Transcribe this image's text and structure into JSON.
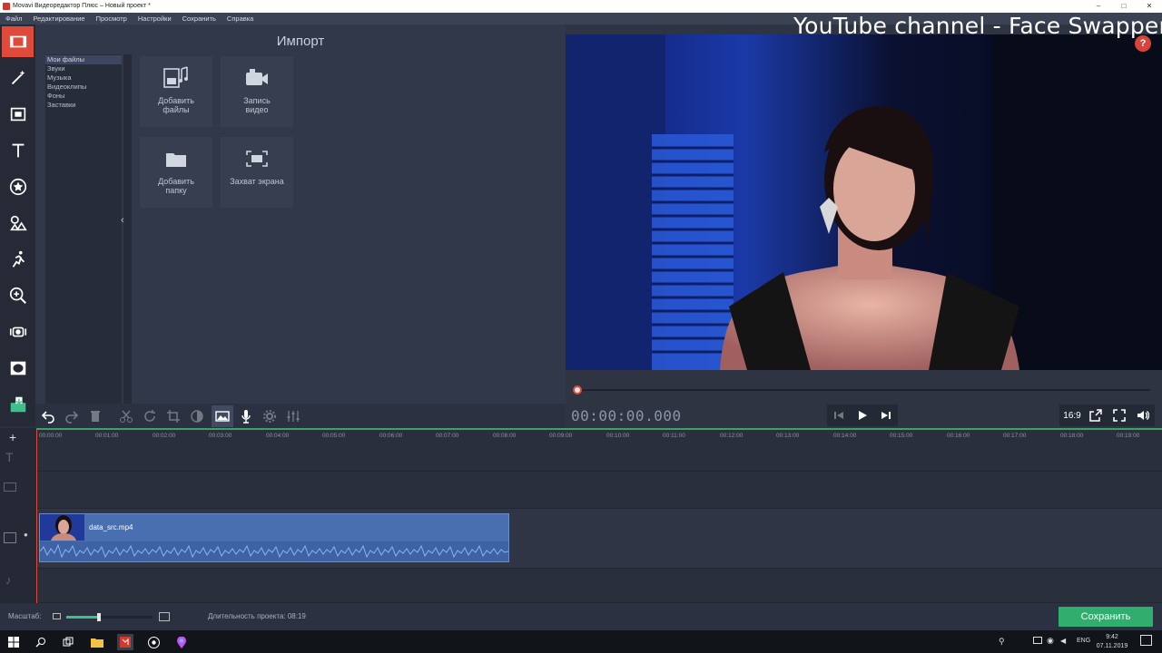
{
  "window": {
    "title": "Movavi Видеоредактор Плюс – Новый проект *",
    "controls": [
      "–",
      "□",
      "✕"
    ]
  },
  "menu": [
    "Файл",
    "Редактирование",
    "Просмотр",
    "Настройки",
    "Сохранить",
    "Справка"
  ],
  "sidebar_tools": [
    "import-icon",
    "magic-wand-icon",
    "filters-icon",
    "titles-icon",
    "stickers-icon",
    "shapes-icon",
    "transitions-icon",
    "zoom-icon",
    "stabilization-icon",
    "vignette-icon",
    "export-icon"
  ],
  "import": {
    "title": "Импорт",
    "categories": [
      "Мои файлы",
      "Звуки",
      "Музыка",
      "Видеоклипы",
      "Фоны",
      "Заставки"
    ],
    "selected_category": "Мои файлы",
    "tiles": [
      {
        "label": "Добавить\nфайлы",
        "icon": "media-files-icon"
      },
      {
        "label": "Запись\nвидео",
        "icon": "camera-icon"
      },
      {
        "label": "Добавить\nпапку",
        "icon": "folder-icon"
      },
      {
        "label": "Захват экрана",
        "icon": "screen-capture-icon"
      }
    ]
  },
  "preview": {
    "watermark": "YouTube channel - Face Swapper",
    "help_label": "?",
    "timecode": "00:00:00.000",
    "aspect": "16:9",
    "seek_position": 0
  },
  "timeline": {
    "ticks": [
      "00:00:00",
      "00:01:00",
      "00:02:00",
      "00:03:00",
      "00:04:00",
      "00:05:00",
      "00:06:00",
      "00:07:00",
      "00:08:00",
      "00:09:00",
      "00:10:00",
      "00:11:00",
      "00:12:00",
      "00:13:00",
      "00:14:00",
      "00:15:00",
      "00:16:00",
      "00:17:00",
      "00:18:00",
      "00:19:00"
    ],
    "clip_name": "data_src.mp4"
  },
  "status": {
    "zoom_label": "Масштаб:",
    "zoom_level": 0.38,
    "duration_label": "Длительность проекта:",
    "duration_value": "08:19",
    "save_label": "Сохранить"
  },
  "taskbar": {
    "lang": "ENG",
    "time": "9:42",
    "date": "07.11.2019"
  },
  "colors": {
    "accent": "#e04a3a",
    "save": "#2fae6e",
    "clip": "#4a6fb0"
  }
}
